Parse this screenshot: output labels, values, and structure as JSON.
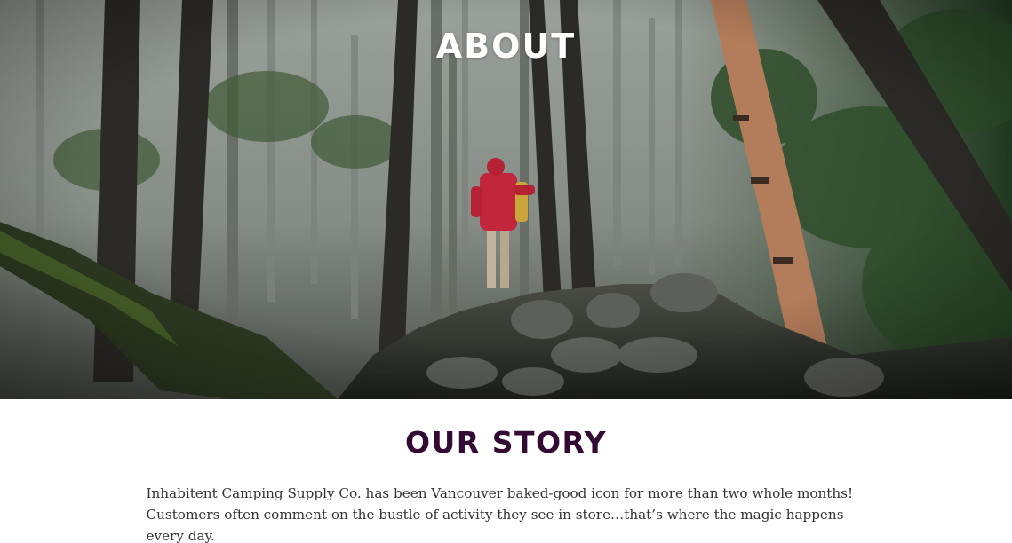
{
  "hero": {
    "title": "ABOUT",
    "image_description_icon": "forest-hiker-photo"
  },
  "story": {
    "title": "OUR STORY",
    "body": "Inhabitent Camping Supply Co. has been Vancouver baked-good icon for more than two whole months! Customers often comment on the bustle of activity they see in store…that’s where the magic happens every day."
  },
  "colors": {
    "story_title": "#330a33",
    "body_text": "#333333",
    "hero_title": "#ffffff"
  }
}
